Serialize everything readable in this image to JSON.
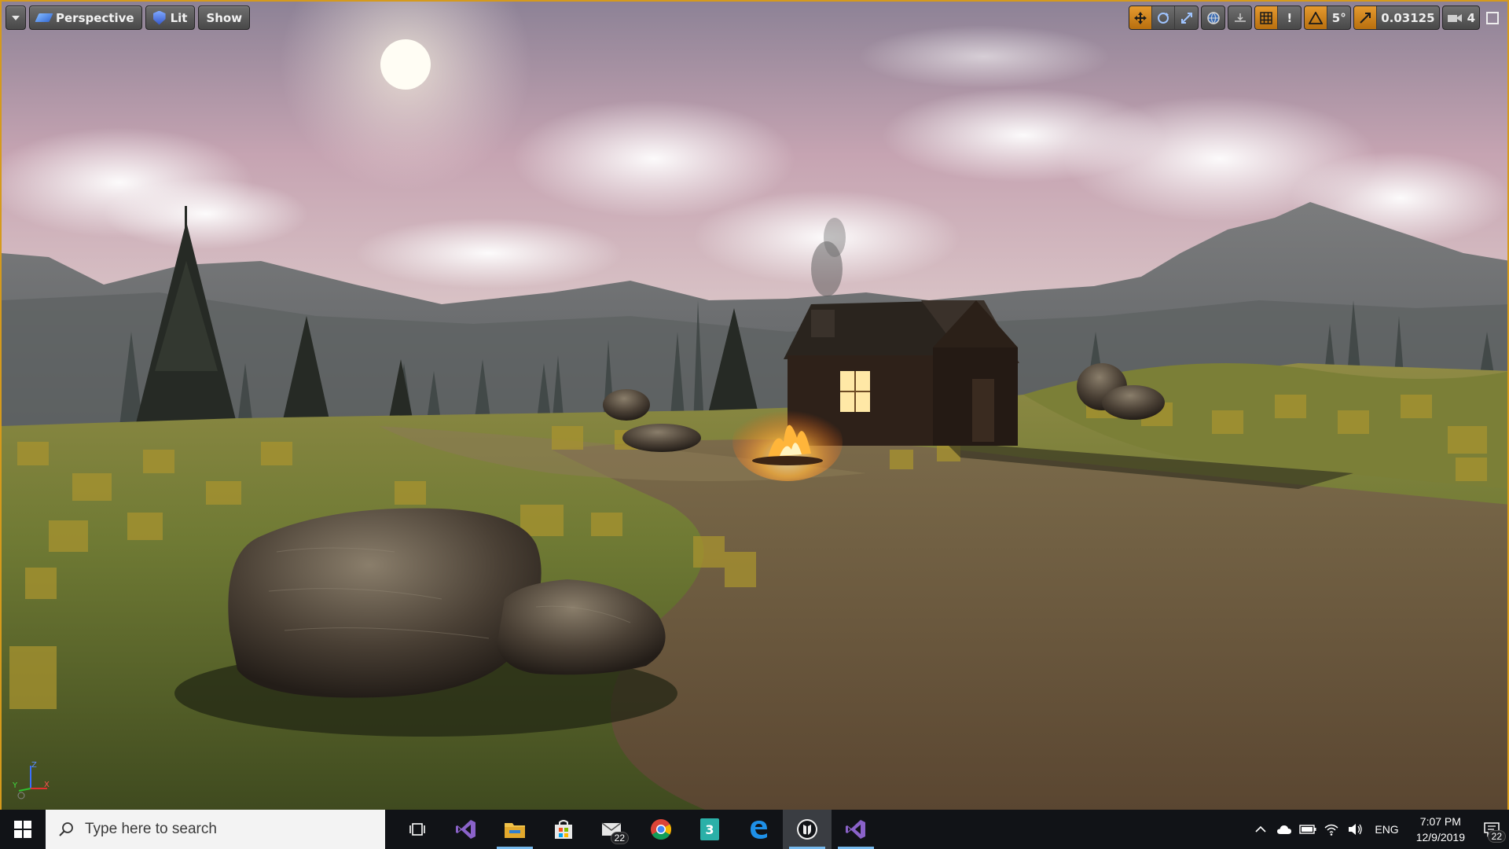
{
  "viewport": {
    "toolbar_left": {
      "perspective_label": "Perspective",
      "lit_label": "Lit",
      "show_label": "Show"
    },
    "toolbar_right": {
      "rotation_snap_value": "5°",
      "camera_speed_value": "0.03125",
      "scale_snap_count": "4",
      "grid_snap_value": "!"
    },
    "axis_gizmo": {
      "x": "X",
      "y": "Y",
      "z": "Z"
    },
    "colors": {
      "accent_orange": "#d59a1c",
      "toolbar_bg": "#5a5a5a"
    }
  },
  "taskbar": {
    "search_placeholder": "Type here to search",
    "apps": [
      {
        "name": "task-view-icon"
      },
      {
        "name": "visual-studio-icon"
      },
      {
        "name": "file-explorer-icon"
      },
      {
        "name": "microsoft-store-icon"
      },
      {
        "name": "mail-icon",
        "badge": "22"
      },
      {
        "name": "chrome-icon"
      },
      {
        "name": "app-3-icon"
      },
      {
        "name": "edge-icon"
      },
      {
        "name": "unreal-engine-icon"
      },
      {
        "name": "visual-studio-2-icon"
      }
    ],
    "tray": {
      "language": "ENG",
      "time": "7:07 PM",
      "date": "12/9/2019",
      "notification_badge": "22"
    }
  }
}
